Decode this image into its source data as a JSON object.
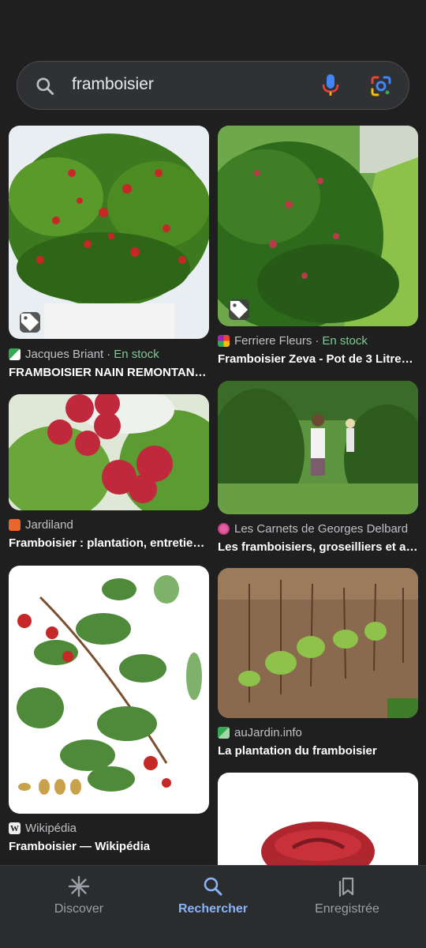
{
  "search": {
    "query": "framboisier"
  },
  "results": [
    {
      "source": "Jacques Briant",
      "stock": "En stock",
      "title": "FRAMBOISIER NAIN REMONTANT ..."
    },
    {
      "source": "Ferriere Fleurs",
      "stock": "En stock",
      "title": "Framboisier Zeva - Pot de 3 Litres |..."
    },
    {
      "source": "Jardiland",
      "stock": "",
      "title": "Framboisier : plantation, entretien ..."
    },
    {
      "source": "Les Carnets de Georges Delbard",
      "stock": "",
      "title": "Les framboisiers, groseilliers et au..."
    },
    {
      "source": "Wikipédia",
      "stock": "",
      "title": "Framboisier — Wikipédia"
    },
    {
      "source": "auJardin.info",
      "stock": "",
      "title": "La plantation du framboisier"
    }
  ],
  "stock_separator": "·",
  "nav": {
    "discover": "Discover",
    "search": "Rechercher",
    "saved": "Enregistrée"
  },
  "colors": {
    "background": "#1f1f1f",
    "active_nav": "#8ab4f8",
    "stock_green": "#81c995"
  }
}
